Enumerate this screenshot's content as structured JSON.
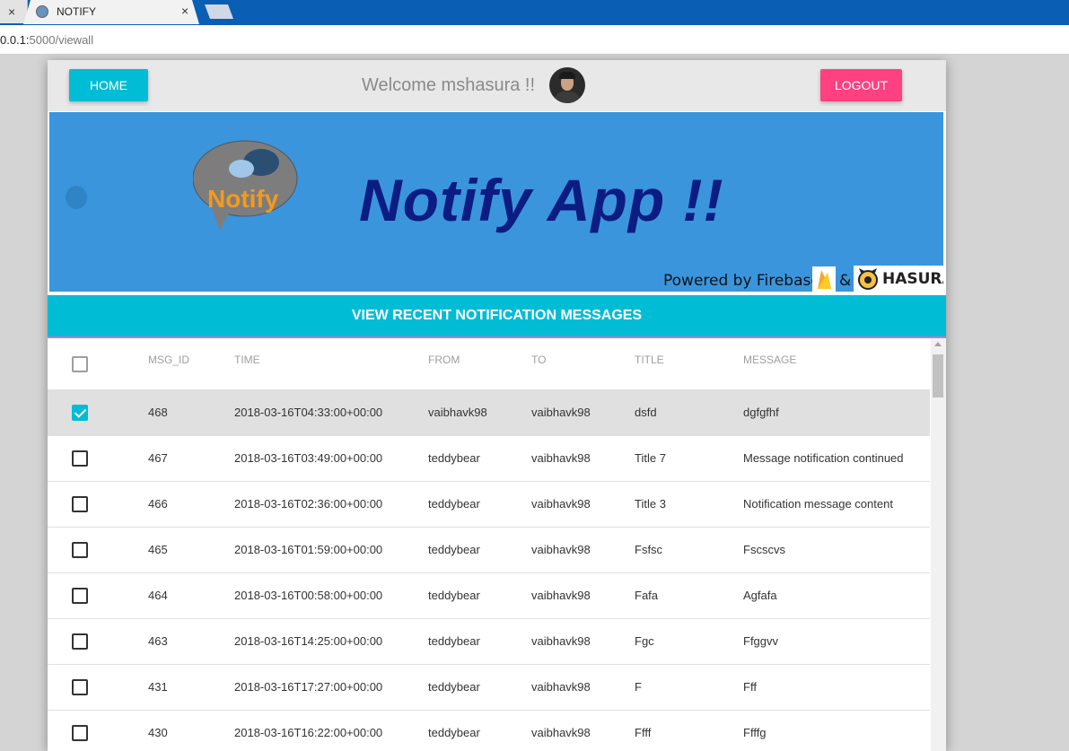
{
  "browser": {
    "inactive_tab_close": "×",
    "tab_title": "NOTIFY",
    "tab_close": "×",
    "url_host": "0.0.1:",
    "url_path": "5000/viewall"
  },
  "header": {
    "home_label": "HOME",
    "welcome_text": "Welcome mshasura !!",
    "logout_label": "LOGOUT"
  },
  "banner": {
    "logo_text": "Notify",
    "title": "Notify App !!",
    "powered_by": "Powered by Firebase",
    "amp": "&",
    "hasura": "HASURA"
  },
  "section_title": "VIEW RECENT NOTIFICATION MESSAGES",
  "table": {
    "columns": [
      "MSG_ID",
      "TIME",
      "FROM",
      "TO",
      "TITLE",
      "MESSAGE"
    ],
    "rows": [
      {
        "msg_id": "468",
        "time": "2018-03-16T04:33:00+00:00",
        "from": "vaibhavk98",
        "to": "vaibhavk98",
        "title": "dsfd",
        "message": "dgfgfhf",
        "checked": true
      },
      {
        "msg_id": "467",
        "time": "2018-03-16T03:49:00+00:00",
        "from": "teddybear",
        "to": "vaibhavk98",
        "title": "Title 7",
        "message": "Message notification continued",
        "checked": false
      },
      {
        "msg_id": "466",
        "time": "2018-03-16T02:36:00+00:00",
        "from": "teddybear",
        "to": "vaibhavk98",
        "title": "Title 3",
        "message": "Notification message content",
        "checked": false
      },
      {
        "msg_id": "465",
        "time": "2018-03-16T01:59:00+00:00",
        "from": "teddybear",
        "to": "vaibhavk98",
        "title": "Fsfsc",
        "message": "Fscscvs",
        "checked": false
      },
      {
        "msg_id": "464",
        "time": "2018-03-16T00:58:00+00:00",
        "from": "teddybear",
        "to": "vaibhavk98",
        "title": "Fafa",
        "message": "Agfafa",
        "checked": false
      },
      {
        "msg_id": "463",
        "time": "2018-03-16T14:25:00+00:00",
        "from": "teddybear",
        "to": "vaibhavk98",
        "title": "Fgc",
        "message": "Ffggvv",
        "checked": false
      },
      {
        "msg_id": "431",
        "time": "2018-03-16T17:27:00+00:00",
        "from": "teddybear",
        "to": "vaibhavk98",
        "title": "F",
        "message": "Fff",
        "checked": false
      },
      {
        "msg_id": "430",
        "time": "2018-03-16T16:22:00+00:00",
        "from": "teddybear",
        "to": "vaibhavk98",
        "title": "Ffff",
        "message": "Ffffg",
        "checked": false
      }
    ]
  },
  "colors": {
    "primary": "#00bcd4",
    "accent": "#ff4081",
    "banner_bg": "#3a95dd",
    "banner_title": "#0c1c82"
  }
}
